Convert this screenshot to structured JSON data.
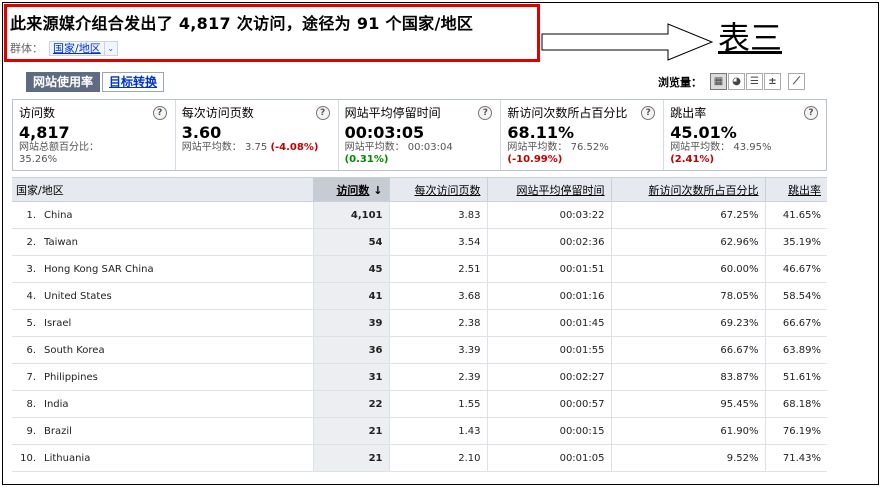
{
  "header": {
    "title": "此来源媒介组合发出了  4,817 次访问，途径为  91 个国家/地区",
    "segment_label": "群体：",
    "segment_value": "国家/地区"
  },
  "annotation": {
    "note_label": "表三"
  },
  "tabs": [
    {
      "label": "网站使用率",
      "active": true
    },
    {
      "label": "目标转换",
      "active": false
    }
  ],
  "view": {
    "label": "浏览量："
  },
  "metrics": [
    {
      "label": "访问数",
      "value": "4,817",
      "note_prefix": "网站总额百分比：",
      "note_value": "35.26%",
      "note_change": ""
    },
    {
      "label": "每次访问页数",
      "value": "3.60",
      "note_prefix": "网站平均数：",
      "note_value": "3.75",
      "note_change": "(-4.08%)"
    },
    {
      "label": "网站平均停留时间",
      "value": "00:03:05",
      "note_prefix": "网站平均数：",
      "note_value": "00:03:04",
      "note_change": "(0.31%)"
    },
    {
      "label": "新访问次数所占百分比",
      "value": "68.11%",
      "note_prefix": "网站平均数：",
      "note_value": "76.52%",
      "note_change": "(-10.99%)"
    },
    {
      "label": "跳出率",
      "value": "45.01%",
      "note_prefix": "网站平均数：",
      "note_value": "43.95%",
      "note_change": "(2.41%)"
    }
  ],
  "table": {
    "headers": {
      "country": "国家/地区",
      "visits": "访问数",
      "sort_arrow": "↓",
      "pages_per_visit": "每次访问页数",
      "avg_time": "网站平均停留时间",
      "new_visits_pct": "新访问次数所占百分比",
      "bounce_rate": "跳出率"
    },
    "rows": [
      {
        "idx": "1.",
        "country": "China",
        "visits": "4,101",
        "pages": "3.83",
        "time": "00:03:22",
        "new_pct": "67.25%",
        "bounce": "41.65%"
      },
      {
        "idx": "2.",
        "country": "Taiwan",
        "visits": "54",
        "pages": "3.54",
        "time": "00:02:36",
        "new_pct": "62.96%",
        "bounce": "35.19%"
      },
      {
        "idx": "3.",
        "country": "Hong Kong SAR China",
        "visits": "45",
        "pages": "2.51",
        "time": "00:01:51",
        "new_pct": "60.00%",
        "bounce": "46.67%"
      },
      {
        "idx": "4.",
        "country": "United States",
        "visits": "41",
        "pages": "3.68",
        "time": "00:01:16",
        "new_pct": "78.05%",
        "bounce": "58.54%"
      },
      {
        "idx": "5.",
        "country": "Israel",
        "visits": "39",
        "pages": "2.38",
        "time": "00:01:45",
        "new_pct": "69.23%",
        "bounce": "66.67%"
      },
      {
        "idx": "6.",
        "country": "South Korea",
        "visits": "36",
        "pages": "3.39",
        "time": "00:01:55",
        "new_pct": "66.67%",
        "bounce": "63.89%"
      },
      {
        "idx": "7.",
        "country": "Philippines",
        "visits": "31",
        "pages": "2.39",
        "time": "00:02:27",
        "new_pct": "83.87%",
        "bounce": "51.61%"
      },
      {
        "idx": "8.",
        "country": "India",
        "visits": "22",
        "pages": "1.55",
        "time": "00:00:57",
        "new_pct": "95.45%",
        "bounce": "68.18%"
      },
      {
        "idx": "9.",
        "country": "Brazil",
        "visits": "21",
        "pages": "1.43",
        "time": "00:00:15",
        "new_pct": "61.90%",
        "bounce": "76.19%"
      },
      {
        "idx": "10.",
        "country": "Lithuania",
        "visits": "21",
        "pages": "2.10",
        "time": "00:01:05",
        "new_pct": "9.52%",
        "bounce": "71.43%"
      }
    ]
  },
  "colors": {
    "highlight_box": "#e00000",
    "negative": "#c00000",
    "positive": "#008800",
    "link": "#0033cc"
  }
}
